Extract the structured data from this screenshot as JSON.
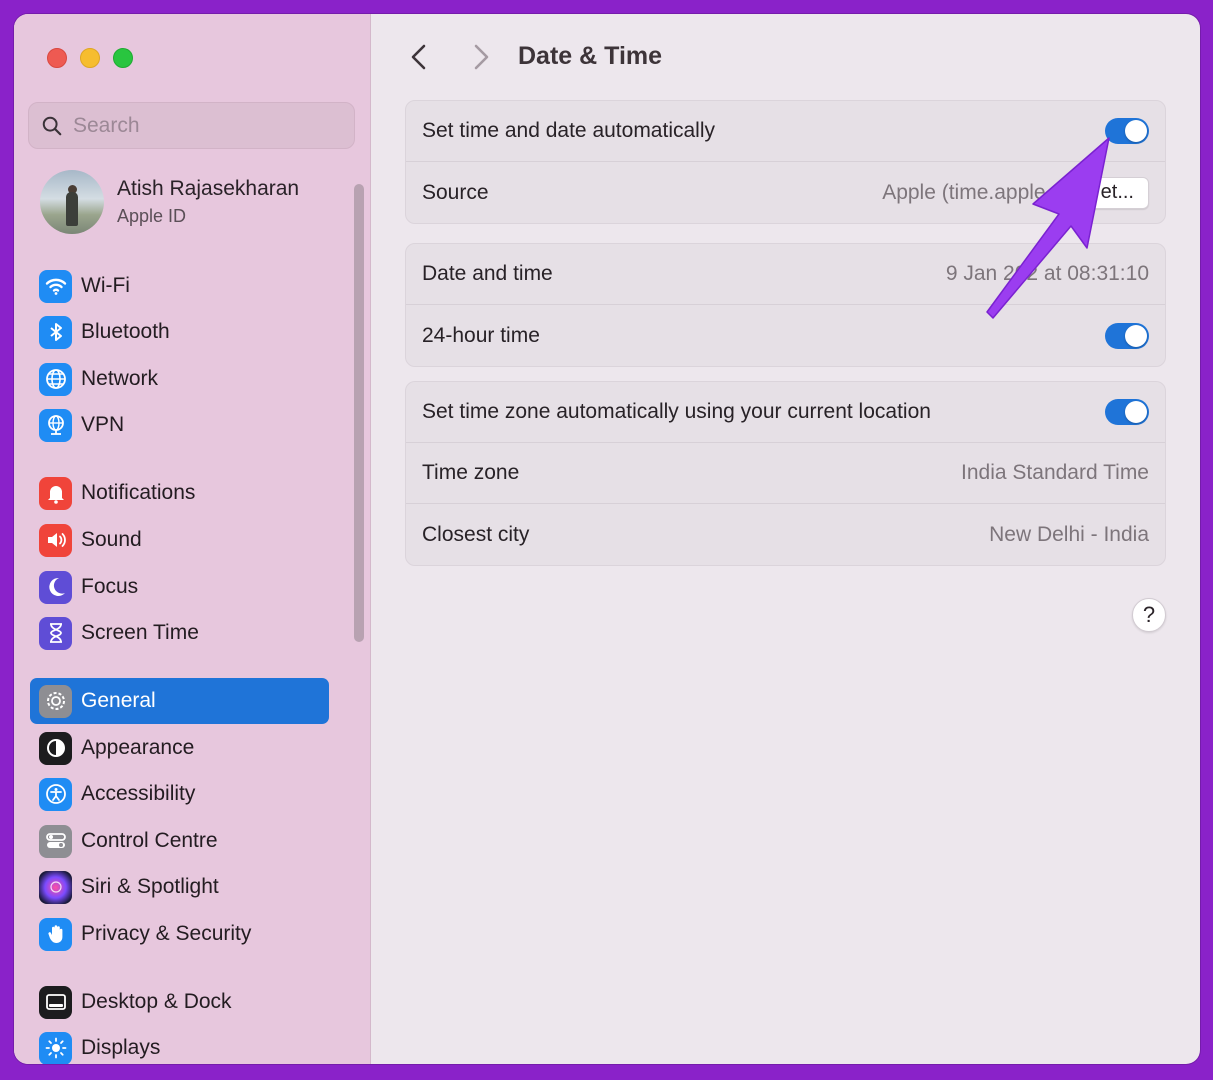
{
  "window": {
    "title": "Date & Time",
    "back_icon": "chevron-left-icon",
    "forward_icon": "chevron-right-icon"
  },
  "sidebar": {
    "search_placeholder": "Search",
    "profile": {
      "name": "Atish Rajasekharan",
      "subtitle": "Apple ID"
    },
    "items": [
      {
        "label": "Wi-Fi",
        "icon": "wifi-icon",
        "color": "#1f8cf4"
      },
      {
        "label": "Bluetooth",
        "icon": "bluetooth-icon",
        "color": "#1f8cf4"
      },
      {
        "label": "Network",
        "icon": "globe-icon",
        "color": "#1f8cf4"
      },
      {
        "label": "VPN",
        "icon": "vpn-globe-icon",
        "color": "#1f8cf4"
      },
      {
        "label": "Notifications",
        "icon": "bell-icon",
        "color": "#f0443a"
      },
      {
        "label": "Sound",
        "icon": "speaker-icon",
        "color": "#f0443a"
      },
      {
        "label": "Focus",
        "icon": "moon-icon",
        "color": "#5f4dd6"
      },
      {
        "label": "Screen Time",
        "icon": "hourglass-icon",
        "color": "#5f4dd6"
      },
      {
        "label": "General",
        "icon": "gear-icon",
        "color": "#8e8e93",
        "active": true
      },
      {
        "label": "Appearance",
        "icon": "appearance-icon",
        "color": "#1c1c1e"
      },
      {
        "label": "Accessibility",
        "icon": "accessibility-icon",
        "color": "#1f8cf4"
      },
      {
        "label": "Control Centre",
        "icon": "toggles-icon",
        "color": "#8e8e93"
      },
      {
        "label": "Siri & Spotlight",
        "icon": "siri-icon",
        "color": "#2b2b6b"
      },
      {
        "label": "Privacy & Security",
        "icon": "hand-icon",
        "color": "#1f8cf4"
      },
      {
        "label": "Desktop & Dock",
        "icon": "dock-icon",
        "color": "#1c1c1e"
      },
      {
        "label": "Displays",
        "icon": "sun-icon",
        "color": "#1f8cf4"
      }
    ]
  },
  "groups": {
    "auto": {
      "set_auto_label": "Set time and date automatically",
      "set_auto_on": true,
      "source_label": "Source",
      "source_value": "Apple (time.apple.co",
      "set_button": "et..."
    },
    "datetime": {
      "date_label": "Date and time",
      "date_value": "9 Jan 202  at 08:31:10",
      "hour24_label": "24-hour time",
      "hour24_on": true
    },
    "timezone": {
      "auto_tz_label": "Set time zone automatically using your current location",
      "auto_tz_on": true,
      "tz_label": "Time zone",
      "tz_value": "India Standard Time",
      "city_label": "Closest city",
      "city_value": "New Delhi - India"
    }
  },
  "help_label": "?",
  "colors": {
    "accent": "#1f74d8",
    "annotation": "#9b3df0",
    "frame": "#8a22c9"
  }
}
